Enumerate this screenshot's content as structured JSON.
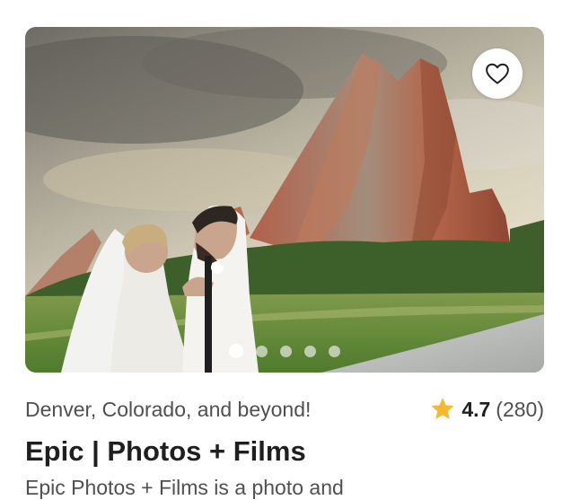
{
  "listing": {
    "location": "Denver, Colorado, and beyond!",
    "rating": "4.7",
    "review_count": "(280)",
    "vendor_name": "Epic | Photos + Films",
    "description_preview": "Epic Photos + Films is a photo and"
  },
  "carousel": {
    "slide_count": 5,
    "active_index": 0
  },
  "icons": {
    "favorite": "heart-outline-icon",
    "rating": "star-filled-icon"
  },
  "colors": {
    "star": "#F5B82E",
    "text_primary": "#1f1f1f",
    "text_secondary": "#505050"
  }
}
